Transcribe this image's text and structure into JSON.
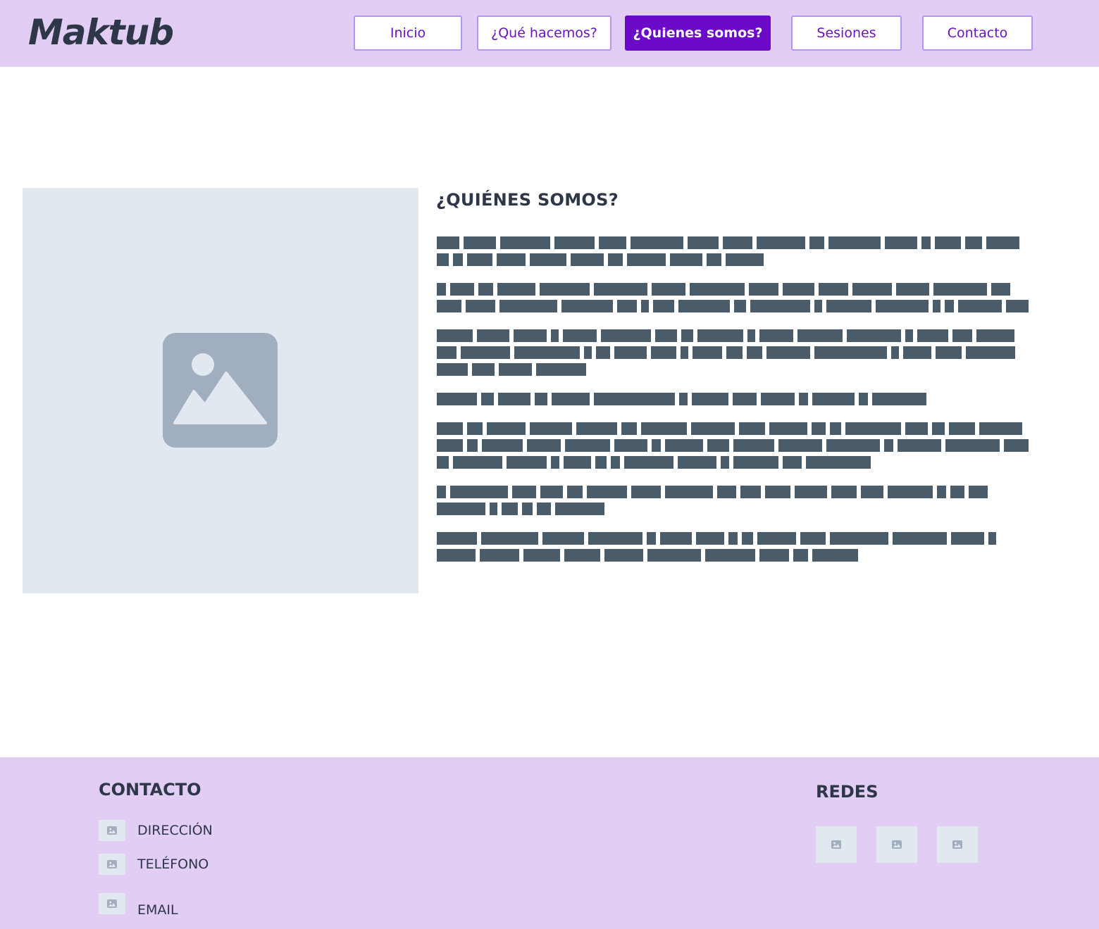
{
  "header": {
    "logo": "Maktub",
    "nav": [
      {
        "label": "Inicio",
        "active": false
      },
      {
        "label": "¿Qué hacemos?",
        "active": false
      },
      {
        "label": "¿Quienes somos?",
        "active": true
      },
      {
        "label": "Sesiones",
        "active": false
      },
      {
        "label": "Contacto",
        "active": false
      }
    ]
  },
  "main": {
    "image_icon": "image-placeholder-icon",
    "title": "¿QUIÉNES SOMOS?",
    "paragraph_count": 7
  },
  "footer": {
    "contact_title": "CONTACTO",
    "contact_items": [
      {
        "icon": "image-placeholder-icon",
        "label": "DIRECCIÓN"
      },
      {
        "icon": "image-placeholder-icon",
        "label": "TELÉFONO"
      },
      {
        "icon": "image-placeholder-icon",
        "label": "EMAIL"
      }
    ],
    "social_title": "REDES",
    "social_icons": [
      "image-placeholder-icon",
      "image-placeholder-icon",
      "image-placeholder-icon"
    ]
  },
  "colors": {
    "header_bg": "#e2cdf4",
    "accent": "#6b0ac9",
    "placeholder_bg": "#e2e8f0",
    "placeholder_icon": "#a0aec0",
    "text_dark": "#2d3748",
    "redacted_text": "#4a5b6a"
  }
}
